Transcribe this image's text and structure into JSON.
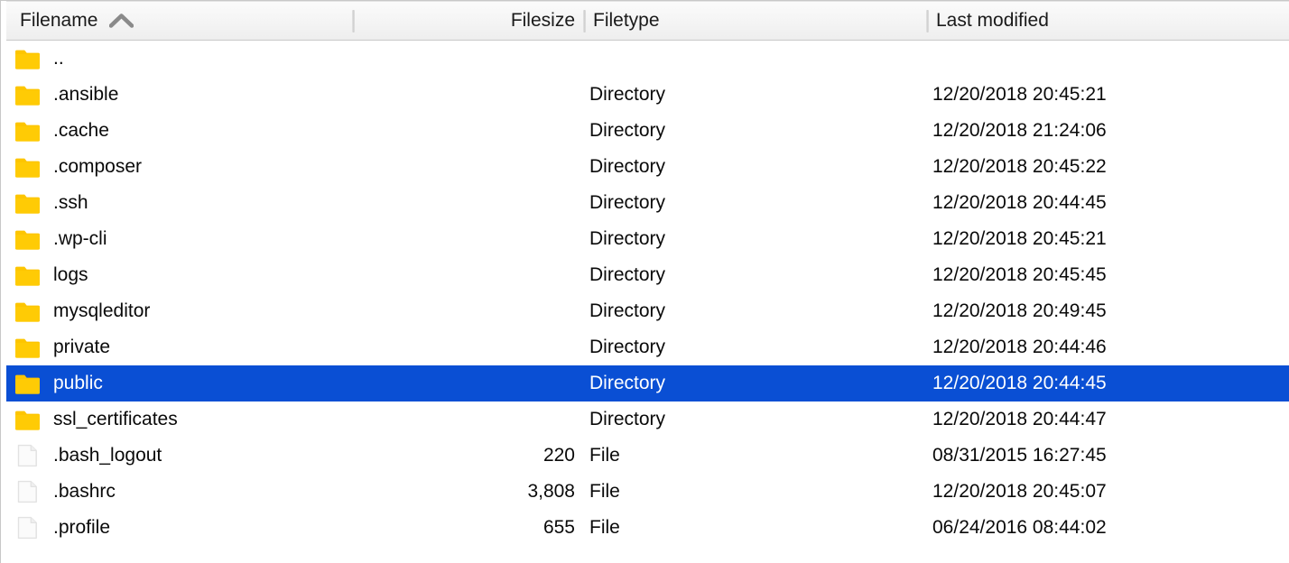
{
  "pane": {
    "title": "file-listing-pane",
    "accent_selection_color": "#0a4fd4",
    "folder_icon_color": "#fdc500",
    "file_icon_color": "#f2f2f2"
  },
  "columns": {
    "filename": {
      "label": "Filename",
      "sort": "ascending",
      "sort_icon": "chevron-up-icon"
    },
    "filesize": {
      "label": "Filesize"
    },
    "filetype": {
      "label": "Filetype"
    },
    "lastmodified": {
      "label": "Last modified"
    }
  },
  "rows": [
    {
      "icon": "folder-icon",
      "name": "..",
      "size": "",
      "type": "",
      "modified": "",
      "selected": false
    },
    {
      "icon": "folder-icon",
      "name": ".ansible",
      "size": "",
      "type": "Directory",
      "modified": "12/20/2018 20:45:21",
      "selected": false
    },
    {
      "icon": "folder-icon",
      "name": ".cache",
      "size": "",
      "type": "Directory",
      "modified": "12/20/2018 21:24:06",
      "selected": false
    },
    {
      "icon": "folder-icon",
      "name": ".composer",
      "size": "",
      "type": "Directory",
      "modified": "12/20/2018 20:45:22",
      "selected": false
    },
    {
      "icon": "folder-icon",
      "name": ".ssh",
      "size": "",
      "type": "Directory",
      "modified": "12/20/2018 20:44:45",
      "selected": false
    },
    {
      "icon": "folder-icon",
      "name": ".wp-cli",
      "size": "",
      "type": "Directory",
      "modified": "12/20/2018 20:45:21",
      "selected": false
    },
    {
      "icon": "folder-icon",
      "name": "logs",
      "size": "",
      "type": "Directory",
      "modified": "12/20/2018 20:45:45",
      "selected": false
    },
    {
      "icon": "folder-icon",
      "name": "mysqleditor",
      "size": "",
      "type": "Directory",
      "modified": "12/20/2018 20:49:45",
      "selected": false
    },
    {
      "icon": "folder-icon",
      "name": "private",
      "size": "",
      "type": "Directory",
      "modified": "12/20/2018 20:44:46",
      "selected": false
    },
    {
      "icon": "folder-icon",
      "name": "public",
      "size": "",
      "type": "Directory",
      "modified": "12/20/2018 20:44:45",
      "selected": true
    },
    {
      "icon": "folder-icon",
      "name": "ssl_certificates",
      "size": "",
      "type": "Directory",
      "modified": "12/20/2018 20:44:47",
      "selected": false
    },
    {
      "icon": "file-icon",
      "name": ".bash_logout",
      "size": "220",
      "type": "File",
      "modified": "08/31/2015 16:27:45",
      "selected": false
    },
    {
      "icon": "file-icon",
      "name": ".bashrc",
      "size": "3,808",
      "type": "File",
      "modified": "12/20/2018 20:45:07",
      "selected": false
    },
    {
      "icon": "file-icon",
      "name": ".profile",
      "size": "655",
      "type": "File",
      "modified": "06/24/2016 08:44:02",
      "selected": false
    }
  ]
}
